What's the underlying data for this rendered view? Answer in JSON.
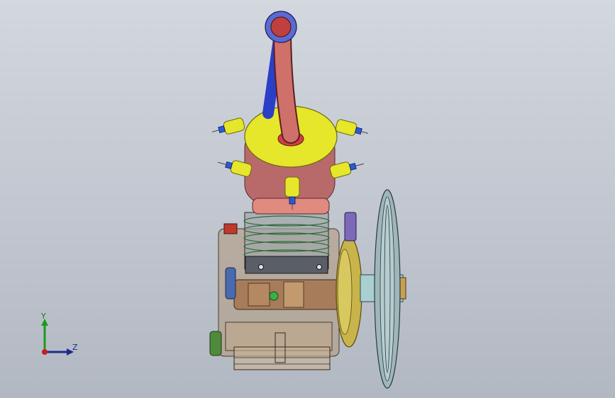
{
  "viewport": {
    "background_top": "#d3d7de",
    "background_bottom": "#b2b8c2"
  },
  "triad": {
    "y_label": "Y",
    "z_label": "Z",
    "y_color": "#1b9a1b",
    "z_color": "#1e2a8c",
    "origin_color": "#c81e1e"
  },
  "model": {
    "components": [
      "exhaust-pipe",
      "cylinder-head",
      "spark-plug",
      "cylinder-barrel",
      "crankcase",
      "flywheel",
      "pulley"
    ],
    "colors": {
      "head_top": "#e6e62a",
      "head_body": "#b86a6a",
      "pipe": "#d0706a",
      "pipe_flange": "#5060c8",
      "crankcase": "#a88f6e",
      "flywheel": "#c8b44a",
      "pulley": "#9fb7ba"
    }
  }
}
